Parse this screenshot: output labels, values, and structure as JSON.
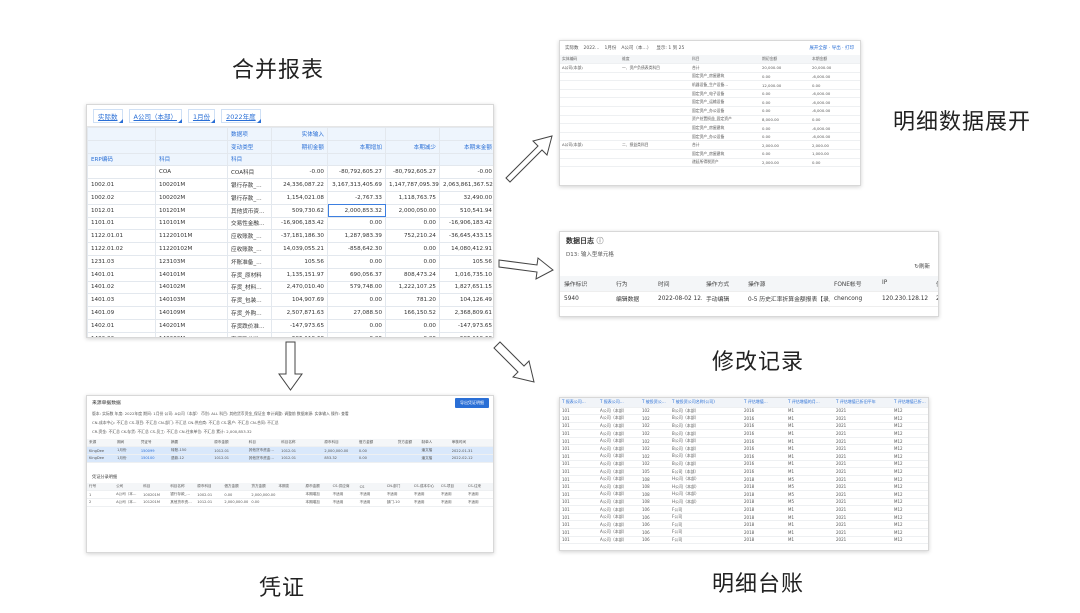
{
  "labels": {
    "merged": "合并报表",
    "detail_expand": "明细数据展开",
    "modify_log": "修改记录",
    "voucher": "凭证",
    "detail_ledger": "明细台账"
  },
  "main": {
    "filters": [
      "实际数",
      "A公司（本部）",
      "1月份",
      "2022年度"
    ],
    "header_row1": [
      "",
      "",
      "数据项",
      "实体输入",
      "",
      "",
      ""
    ],
    "header_row2": [
      "",
      "",
      "变动类型",
      "期初金额",
      "本期增加",
      "本期减少",
      "本期末金额"
    ],
    "header_row3": [
      "ERP编码",
      "科目",
      "科目",
      "",
      "",
      "",
      ""
    ],
    "rows": [
      {
        "a": "",
        "b": "COA",
        "c": "COA科目",
        "v1": "-0.00",
        "v2": "-80,792,605.27",
        "v3": "-80,792,605.27",
        "v4": "-0.00"
      },
      {
        "a": "1002.01",
        "b": "100201M",
        "c": "银行存款_…",
        "v1": "24,336,087.22",
        "v2": "3,167,313,405.69",
        "v3": "1,147,787,095.39",
        "v4": "2,063,861,367.52"
      },
      {
        "a": "1002.02",
        "b": "100202M",
        "c": "银行存款_…",
        "v1": "1,154,021.08",
        "v2": "-2,767.33",
        "v3": "1,118,763.75",
        "v4": "32,490.00"
      },
      {
        "a": "1012.01",
        "b": "101201M",
        "c": "其他货币资…",
        "v1": "509,730.62",
        "v2": "2,000,853.32",
        "v3": "2,000,050.00",
        "v4": "510,541.94"
      },
      {
        "a": "1101.01",
        "b": "110101M",
        "c": "交易性金融…",
        "v1": "-16,906,183.42",
        "v2": "0.00",
        "v3": "0.00",
        "v4": "-16,906,183.42"
      },
      {
        "a": "1122.01.01",
        "b": "1122010​1M",
        "c": "应收账款_…",
        "v1": "-37,181,186.30",
        "v2": "1,287,983.39",
        "v3": "752,210.24",
        "v4": "-36,645,433.15"
      },
      {
        "a": "1122.01.02",
        "b": "1122010​2M",
        "c": "应收账款_…",
        "v1": "14,039,055.21",
        "v2": "-858,642.30",
        "v3": "0.00",
        "v4": "14,080,412.91"
      },
      {
        "a": "1231.03",
        "b": "123103M",
        "c": "坏账准备_…",
        "v1": "105.56",
        "v2": "0.00",
        "v3": "0.00",
        "v4": "105.56"
      },
      {
        "a": "1401.01",
        "b": "140101M",
        "c": "存货_原材料",
        "v1": "1,135,151.97",
        "v2": "690,056.37",
        "v3": "808,473.24",
        "v4": "1,016,735.10"
      },
      {
        "a": "1401.02",
        "b": "140102M",
        "c": "存货_材料…",
        "v1": "2,470,010.40",
        "v2": "579,748.00",
        "v3": "1,222,107.25",
        "v4": "1,827,651.15"
      },
      {
        "a": "1401.03",
        "b": "140103M",
        "c": "存货_包装…",
        "v1": "104,907.69",
        "v2": "0.00",
        "v3": "781.20",
        "v4": "104,126.49"
      },
      {
        "a": "1401.09",
        "b": "140109M",
        "c": "存货_外购…",
        "v1": "2,507,871.63",
        "v2": "27,088.50",
        "v3": "166,150.52",
        "v4": "2,368,809.61"
      },
      {
        "a": "1402.01",
        "b": "140201M",
        "c": "存货跌价准…",
        "v1": "-147,973.65",
        "v2": "0.00",
        "v3": "0.00",
        "v4": "-147,973.65"
      },
      {
        "a": "1402.02",
        "b": "140202M",
        "c": "存货跌价准…",
        "v1": "-595,110.60",
        "v2": "0.00",
        "v3": "0.00",
        "v4": "-595,110.60"
      }
    ]
  },
  "log": {
    "title": "数据日志",
    "subtitle": "D13: 输入型单元格",
    "refresh": "刷新",
    "headers": [
      "操作标识",
      "行为",
      "时间",
      "操作方式",
      "操作源",
      "FONE帐号",
      "IP",
      "值"
    ],
    "row": [
      "5940",
      "编辑数据",
      "2022-08-02 12…",
      "手动编辑",
      "0-5 历史汇率折算金额报表【录入…",
      "chencong",
      "120.230.128.12",
      "2010000"
    ]
  },
  "detail": {
    "toolbar": [
      "实际数",
      "2022…",
      "1月份",
      "A公司（本…）",
      "显示: 1 到 25"
    ],
    "toolbar_right": "展开全部 · 导出 · 打印",
    "headers": [
      "实体编码",
      "维度",
      "科目",
      "期初金额",
      "本期金额"
    ],
    "rows": [
      [
        "A公司(本部)",
        "一、资产负债表类科目",
        "合计",
        "20,000.00",
        "20,000.00"
      ],
      [
        "",
        "",
        "固定资产_房屋建筑",
        "0.00",
        "-6,000.00"
      ],
      [
        "",
        "",
        "机器设备_生产设备…",
        "12,000.00",
        "0.00"
      ],
      [
        "",
        "",
        "固定资产_电子设备",
        "0.00",
        "-6,000.00"
      ],
      [
        "",
        "",
        "固定资产_运输设备",
        "0.00",
        "-6,000.00"
      ],
      [
        "",
        "",
        "固定资产_办公设备",
        "0.00",
        "-6,000.00"
      ],
      [
        "",
        "",
        "资产处置损益_固定资产",
        "8,000.00",
        "0.00"
      ],
      [
        "",
        "",
        "固定资产_房屋建筑",
        "0.00",
        "-6,000.00"
      ],
      [
        "",
        "",
        "固定资产_办公设备",
        "0.00",
        "-6,000.00"
      ],
      [
        "A公司(本部)",
        "二、损益类科目",
        "合计",
        "2,000.00",
        "2,000.00"
      ],
      [
        "",
        "",
        "固定资产_房屋建筑",
        "0.00",
        "1,000.00"
      ],
      [
        "",
        "",
        "递延所得税资产",
        "2,000.00",
        "0.00"
      ]
    ]
  },
  "voucher": {
    "title": "来源单据数据",
    "button": "导出凭证明细",
    "info": [
      "版本: 实际数   年度: 2022年度   期间: 1月份   公司: A公司（本部）   币别: ALL   科目: 其他货币资金_保证金   审计调整: 调整前   数据来源: 实体输入   操作: 查看",
      "CN-成本中心: 不汇总   CS-项目: 不汇总   CN-部门: 不汇总   CN-供应商: 不汇总   CS-客户: 不汇总   CN-合同: 不汇总",
      "CR-资金: 不汇总   CK-存货: 不汇总   CS-员工: 不汇总   CN-往来单位: 不汇总   累计: 2,000,853.32"
    ],
    "headers": [
      "来源",
      "期间",
      "凭证号",
      "摘要",
      "原币金额",
      "科目",
      "科目名称",
      "原币科目",
      "借方金额",
      "贷方金额",
      "制单人",
      "审核时间"
    ],
    "rows": [
      [
        "KingDee",
        "1月份",
        "150099",
        "转账-150",
        "1012.01",
        "其他货币资金…",
        "1012.01",
        "2,000,000.00",
        "0.00",
        "",
        "潘文楷",
        "2022-01-31"
      ],
      [
        "KingDee",
        "1月份",
        "150100",
        "退款-12",
        "1012.01",
        "其他货币资金…",
        "1012.01",
        "853.32",
        "0.00",
        "",
        "潘文楷",
        "2022-02-12"
      ]
    ],
    "sec_title": "凭证分录明细",
    "sec_headers": [
      "行号",
      "公司",
      "科目",
      "科目名称",
      "原币科目",
      "借方金额",
      "贷方金额",
      "本期变",
      "原币金额",
      "CS-供应商",
      "CS",
      "CN-部门",
      "CS-成本中心",
      "CS-项目",
      "CS-往来"
    ],
    "sec_rows": [
      [
        "1",
        "A公司（本…",
        "100201M",
        "银行存款_…",
        "1002.01",
        "0.00",
        "2,000,000.00",
        "",
        "本期增加",
        "不适用",
        "不适用",
        "不适用",
        "不适用",
        "不适用",
        "不适用"
      ],
      [
        "2",
        "A公司（本…",
        "101201M",
        "其他货币资…",
        "1012.01",
        "2,000,000.00",
        "0.00",
        "",
        "本期增加",
        "不适用",
        "不适用",
        "部门-10",
        "不适用",
        "不适用",
        "不适用"
      ]
    ]
  },
  "ledger": {
    "headers": [
      "报表公司…",
      "报表公司…",
      "被投资公…",
      "被投资公司名称(公司)",
      "评估增值…",
      "评估增值的月…",
      "评估增值已折旧平年",
      "评估增值已折…"
    ],
    "rows": [
      [
        "101",
        "A公司（本部）",
        "102",
        "B公司（本部）",
        "2016",
        "M1",
        "2021",
        "M12"
      ],
      [
        "101",
        "A公司（本部）",
        "102",
        "B公司（本部）",
        "2016",
        "M1",
        "2021",
        "M12"
      ],
      [
        "101",
        "A公司（本部）",
        "102",
        "B公司（本部）",
        "2016",
        "M1",
        "2021",
        "M12"
      ],
      [
        "101",
        "A公司（本部）",
        "102",
        "B公司（本部）",
        "2016",
        "M1",
        "2021",
        "M12"
      ],
      [
        "101",
        "A公司（本部）",
        "102",
        "B公司（本部）",
        "2016",
        "M1",
        "2021",
        "M12"
      ],
      [
        "101",
        "A公司（本部）",
        "102",
        "B公司（本部）",
        "2016",
        "M1",
        "2021",
        "M12"
      ],
      [
        "101",
        "A公司（本部）",
        "102",
        "B公司（本部）",
        "2016",
        "M1",
        "2021",
        "M12"
      ],
      [
        "101",
        "A公司（本部）",
        "102",
        "B公司（本部）",
        "2016",
        "M1",
        "2021",
        "M12"
      ],
      [
        "101",
        "A公司（本部）",
        "105",
        "E公司（本部）",
        "2016",
        "M1",
        "2021",
        "M12"
      ],
      [
        "101",
        "A公司（本部）",
        "108",
        "H公司（本部）",
        "2018",
        "M5",
        "2021",
        "M12"
      ],
      [
        "101",
        "A公司（本部）",
        "108",
        "H公司（本部）",
        "2018",
        "M5",
        "2021",
        "M12"
      ],
      [
        "101",
        "A公司（本部）",
        "108",
        "H公司（本部）",
        "2018",
        "M5",
        "2021",
        "M12"
      ],
      [
        "101",
        "A公司（本部）",
        "108",
        "H公司（本部）",
        "2018",
        "M5",
        "2021",
        "M12"
      ],
      [
        "101",
        "A公司（本部）",
        "106",
        "F公司",
        "2018",
        "M1",
        "2021",
        "M12"
      ],
      [
        "101",
        "A公司（本部）",
        "106",
        "F公司",
        "2018",
        "M1",
        "2021",
        "M12"
      ],
      [
        "101",
        "A公司（本部）",
        "106",
        "F公司",
        "2018",
        "M1",
        "2021",
        "M12"
      ],
      [
        "101",
        "A公司（本部）",
        "106",
        "F公司",
        "2018",
        "M1",
        "2021",
        "M12"
      ],
      [
        "101",
        "A公司（本部）",
        "106",
        "F公司",
        "2018",
        "M1",
        "2021",
        "M12"
      ]
    ]
  }
}
